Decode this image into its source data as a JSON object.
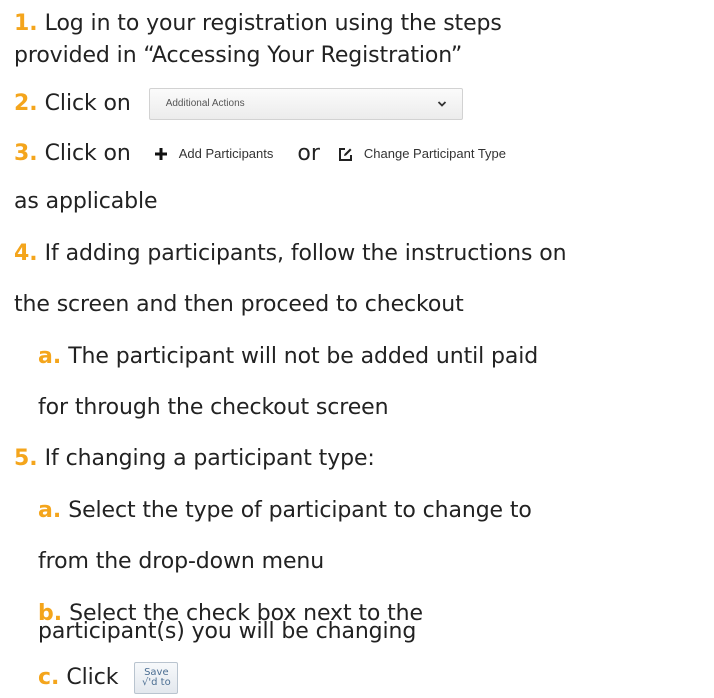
{
  "accent_color": "#f4a51c",
  "steps": {
    "step1": {
      "num": "1.",
      "line1": "Log in to your registration using the steps",
      "line2": "provided in “Accessing Your Registration”"
    },
    "step2": {
      "num": "2.",
      "text": "Click on",
      "dropdown_label": "Additional Actions"
    },
    "step3": {
      "num": "3.",
      "text": "Click on",
      "add_label": "Add Participants",
      "or": "or",
      "change_label": "Change Participant Type",
      "line2": "as applicable"
    },
    "step4": {
      "num": "4.",
      "line1": "If adding participants, follow the instructions on",
      "line2": "the screen and then proceed to checkout",
      "sub_a": {
        "num": "a.",
        "line1": "The participant will not be added until paid",
        "line2": "for through the checkout screen"
      }
    },
    "step5": {
      "num": "5.",
      "text": "If changing a participant type:",
      "sub_a": {
        "num": "a.",
        "line1": "Select the type of participant to change to",
        "line2": "from the drop-down menu"
      },
      "sub_b": {
        "num": "b.",
        "line1": "Select the check box next to the",
        "line2": "participant(s) you will be changing"
      },
      "sub_c": {
        "num": "c.",
        "text": "Click",
        "save_line1": "Save",
        "save_line2": "√'d to"
      }
    }
  }
}
